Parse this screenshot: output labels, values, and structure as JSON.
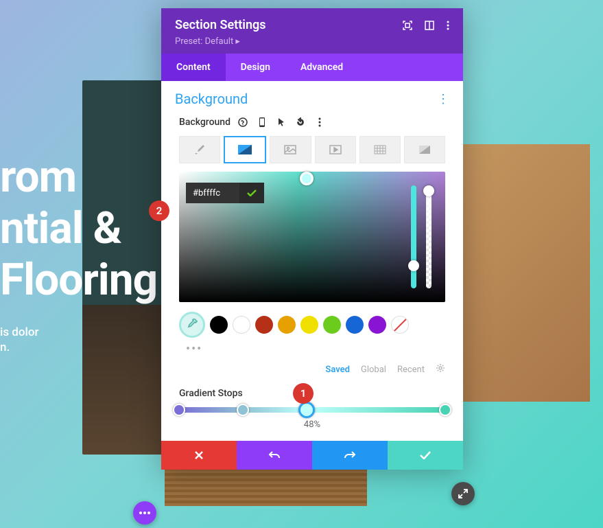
{
  "hero": {
    "line1": "rom",
    "line2": "ntial &",
    "line3": "Flooring",
    "sub1": "is dolor",
    "sub2": "n."
  },
  "panel": {
    "title": "Section Settings",
    "preset": "Preset: Default ▸",
    "tabs": {
      "content": "Content",
      "design": "Design",
      "advanced": "Advanced"
    },
    "section_title": "Background",
    "field_label": "Background",
    "hex": "#bffffc",
    "palette": {
      "saved": "Saved",
      "global": "Global",
      "recent": "Recent"
    },
    "gradient_label": "Gradient Stops",
    "gradient_percent": "48%"
  },
  "badges": {
    "one": "1",
    "two": "2"
  },
  "swatches": [
    {
      "name": "black",
      "hex": "#000000"
    },
    {
      "name": "white",
      "hex": "#ffffff"
    },
    {
      "name": "red",
      "hex": "#b53016"
    },
    {
      "name": "orange",
      "hex": "#e6a000"
    },
    {
      "name": "yellow",
      "hex": "#f0e000"
    },
    {
      "name": "green",
      "hex": "#6bcc1e"
    },
    {
      "name": "blue",
      "hex": "#1766d6"
    },
    {
      "name": "purple",
      "hex": "#8a14d4"
    }
  ],
  "gradient_stops": [
    {
      "pos": 0,
      "hex": "#7a6fd4"
    },
    {
      "pos": 24,
      "hex": "#8fc2d4"
    },
    {
      "pos": 48,
      "hex": "#bffffc",
      "active": true
    },
    {
      "pos": 100,
      "hex": "#49d3b5"
    }
  ]
}
